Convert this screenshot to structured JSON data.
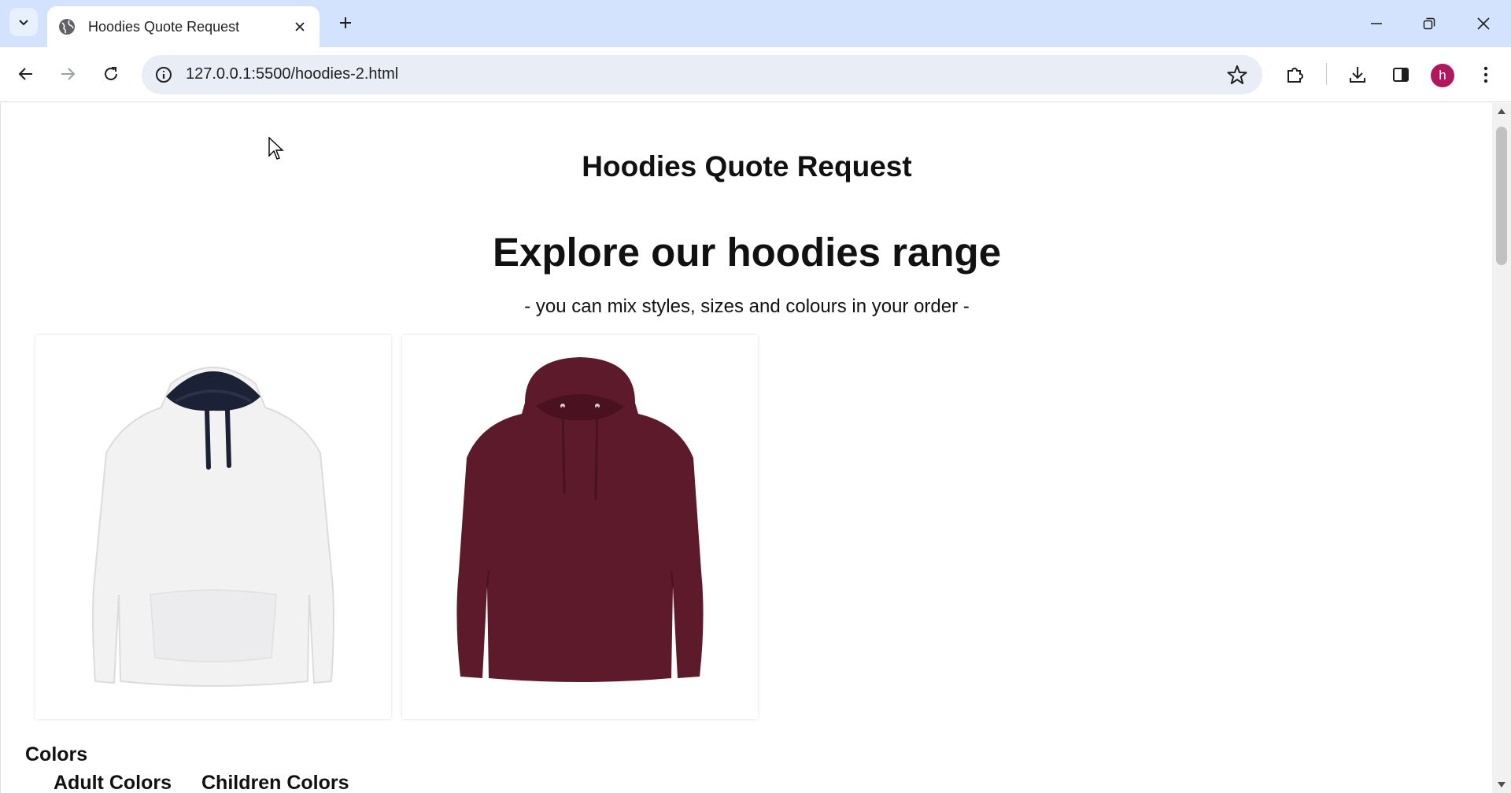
{
  "browser": {
    "tab_title": "Hoodies Quote Request",
    "url": "127.0.0.1:5500/hoodies-2.html",
    "profile_initial": "h",
    "profile_color": "#b0175c",
    "tabstrip_color": "#d3e3fd"
  },
  "page": {
    "heading": "Hoodies Quote Request",
    "hero_title": "Explore our hoodies range",
    "hero_subtitle": "- you can mix styles, sizes and colours in your order -",
    "products": [
      {
        "image": "white-hoodie-navy-hood",
        "body_color": "#f2f2f3",
        "accent_color": "#1c2235"
      },
      {
        "image": "burgundy-hoodie",
        "body_color": "#5c1a2a",
        "accent_color": "#4a1220"
      }
    ],
    "colors_section": {
      "title": "Colors",
      "tabs": [
        "Adult Colors",
        "Children Colors"
      ]
    }
  },
  "icons": {
    "tab_search": "chevron-down-icon",
    "favicon": "globe-icon",
    "tab_close": "close-icon",
    "new_tab": "plus-icon",
    "minimize": "minimize-icon",
    "restore": "restore-icon",
    "window_close": "close-icon",
    "back": "arrow-left-icon",
    "forward": "arrow-right-icon",
    "reload": "reload-icon",
    "site_info": "info-icon",
    "bookmark": "star-icon",
    "extensions": "puzzle-icon",
    "downloads": "download-icon",
    "side_panel": "side-panel-icon",
    "menu": "kebab-menu-icon"
  }
}
